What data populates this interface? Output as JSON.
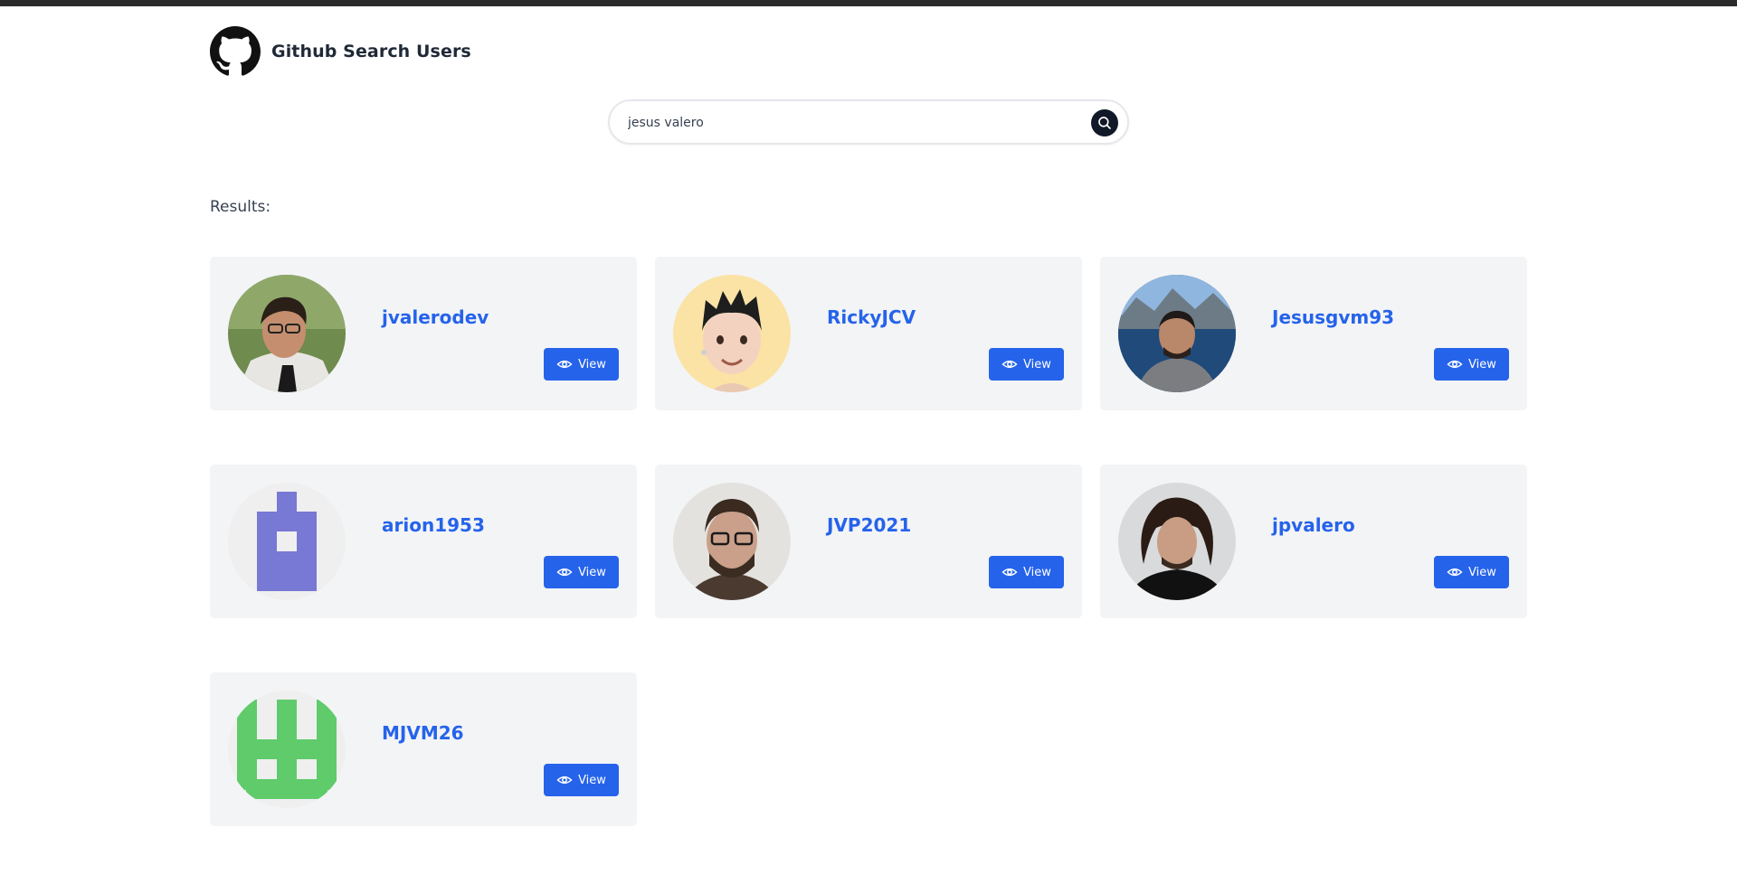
{
  "app": {
    "title": "Github Search Users"
  },
  "search": {
    "value": "jesus valero"
  },
  "results_label": "Results:",
  "icons": {
    "logo": "github-logo",
    "search": "search-icon",
    "view": "eye-icon"
  },
  "colors": {
    "accent": "#2563eb",
    "card_bg": "#f3f4f6",
    "search_button": "#111827"
  },
  "users": [
    {
      "login": "jvalerodev",
      "view_label": "View"
    },
    {
      "login": "RickyJCV",
      "view_label": "View"
    },
    {
      "login": "Jesusgvm93",
      "view_label": "View"
    },
    {
      "login": "arion1953",
      "view_label": "View"
    },
    {
      "login": "JVP2021",
      "view_label": "View"
    },
    {
      "login": "jpvalero",
      "view_label": "View"
    },
    {
      "login": "MJVM26",
      "view_label": "View"
    }
  ]
}
